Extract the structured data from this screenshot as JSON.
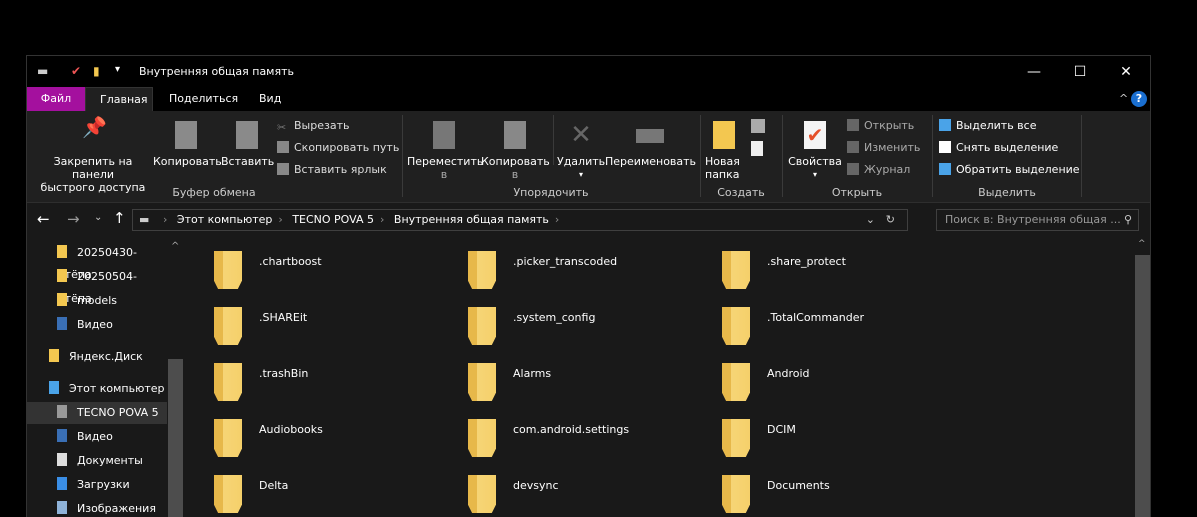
{
  "window": {
    "title": "Внутренняя общая память",
    "minimize": "—",
    "maximize": "☐",
    "close": "✕",
    "collapse": "^",
    "help": "?"
  },
  "tabs": [
    "Файл",
    "Главная",
    "Поделиться",
    "Вид"
  ],
  "ribbon": {
    "clipboard": {
      "pin": "Закрепить на панели быстрого доступа",
      "pin_l1": "Закрепить на панели",
      "pin_l2": "быстрого доступа",
      "copy": "Копировать",
      "paste": "Вставить",
      "cut": "Вырезать",
      "copy_path": "Скопировать путь",
      "paste_shortcut": "Вставить ярлык",
      "group": "Буфер обмена"
    },
    "organize": {
      "move_l1": "Переместить",
      "move_l2": "в",
      "copy_l1": "Копировать",
      "copy_l2": "в",
      "delete": "Удалить",
      "rename": "Переименовать",
      "group": "Упорядочить"
    },
    "new": {
      "folder_l1": "Новая",
      "folder_l2": "папка",
      "group": "Создать"
    },
    "open": {
      "properties": "Свойства",
      "open": "Открыть",
      "edit": "Изменить",
      "history": "Журнал",
      "group": "Открыть"
    },
    "select": {
      "all": "Выделить все",
      "none": "Снять выделение",
      "invert": "Обратить выделение",
      "group": "Выделить"
    }
  },
  "breadcrumb": [
    "Этот компьютер",
    "TECNO POVA 5",
    "Внутренняя общая память"
  ],
  "search_placeholder": "Поиск в: Внутренняя общая ...",
  "sidebar": [
    {
      "label": "20250430-Стёпа",
      "icon": "folder-icon"
    },
    {
      "label": "20250504-Стёпа",
      "icon": "folder-icon"
    },
    {
      "label": "models",
      "icon": "folder-icon"
    },
    {
      "label": "Видео",
      "icon": "video-icon"
    },
    {
      "label": "Яндекс.Диск",
      "icon": "yandex-disk-icon"
    },
    {
      "label": "Этот компьютер",
      "icon": "computer-icon"
    },
    {
      "label": "TECNO POVA 5",
      "icon": "phone-icon",
      "selected": true
    },
    {
      "label": "Видео",
      "icon": "video-icon"
    },
    {
      "label": "Документы",
      "icon": "documents-icon"
    },
    {
      "label": "Загрузки",
      "icon": "downloads-icon"
    },
    {
      "label": "Изображения",
      "icon": "pictures-icon"
    }
  ],
  "folders": [
    ".chartboost",
    ".picker_transcoded",
    ".share_protect",
    ".SHAREit",
    ".system_config",
    ".TotalCommander",
    ".trashBin",
    "Alarms",
    "Android",
    "Audiobooks",
    "com.android.settings",
    "DCIM",
    "Delta",
    "devsync",
    "Documents"
  ]
}
